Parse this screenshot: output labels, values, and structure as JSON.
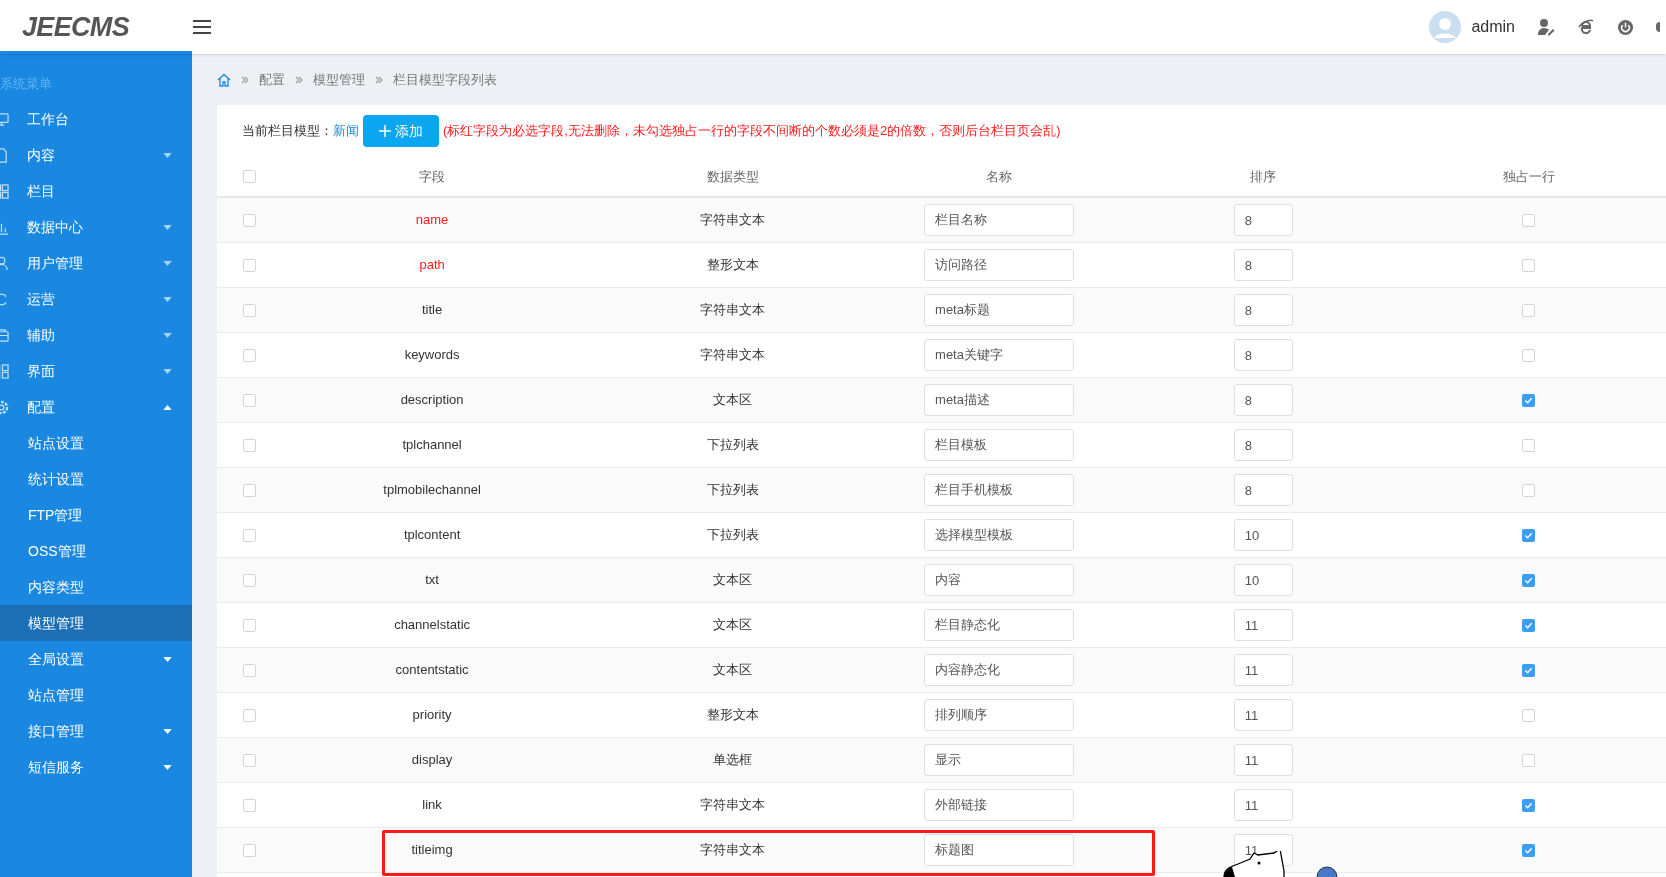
{
  "topbar": {
    "logo": "JEECMS",
    "user": "admin"
  },
  "sidebar": {
    "heading": "系统菜单",
    "items": [
      {
        "label": "工作台",
        "kind": "top",
        "selected": false
      },
      {
        "label": "内容",
        "kind": "top",
        "expanded": false,
        "selected": false
      },
      {
        "label": "栏目",
        "kind": "top",
        "selected": false
      },
      {
        "label": "数据中心",
        "kind": "top",
        "expanded": false,
        "selected": false
      },
      {
        "label": "用户管理",
        "kind": "top",
        "expanded": false,
        "selected": false
      },
      {
        "label": "运营",
        "kind": "top",
        "expanded": false,
        "selected": false
      },
      {
        "label": "辅助",
        "kind": "top",
        "expanded": false,
        "selected": false
      },
      {
        "label": "界面",
        "kind": "top",
        "expanded": false,
        "selected": false
      },
      {
        "label": "配置",
        "kind": "top",
        "expanded": true,
        "selected": false
      },
      {
        "label": "站点设置",
        "kind": "sub",
        "selected": false
      },
      {
        "label": "统计设置",
        "kind": "sub",
        "selected": false
      },
      {
        "label": "FTP管理",
        "kind": "sub",
        "selected": false
      },
      {
        "label": "OSS管理",
        "kind": "sub",
        "selected": false
      },
      {
        "label": "内容类型",
        "kind": "sub",
        "selected": false
      },
      {
        "label": "模型管理",
        "kind": "sub",
        "selected": true
      },
      {
        "label": "全局设置",
        "kind": "sub",
        "expanded": false,
        "selected": false
      },
      {
        "label": "站点管理",
        "kind": "sub",
        "selected": false
      },
      {
        "label": "接口管理",
        "kind": "sub",
        "expanded": false,
        "selected": false
      },
      {
        "label": "短信服务",
        "kind": "sub",
        "expanded": false,
        "selected": false
      }
    ]
  },
  "breadcrumb": [
    "配置",
    "模型管理",
    "栏目模型字段列表"
  ],
  "toolbar": {
    "label": "当前栏目模型：",
    "model": "新闻",
    "add_button": "添加",
    "notice": "(标红字段为必选字段,无法删除，未勾选独占一行的字段不间断的个数必须是2的倍数，否则后台栏目页会乱)"
  },
  "table": {
    "columns": [
      "字段",
      "数据类型",
      "名称",
      "排序",
      "独占一行"
    ],
    "header_checked": false,
    "rows": [
      {
        "field": "name",
        "type": "字符串文本",
        "name": "栏目名称",
        "order": "8",
        "single_line": false,
        "required": true,
        "selected": false,
        "highlighted": false
      },
      {
        "field": "path",
        "type": "整形文本",
        "name": "访问路径",
        "order": "8",
        "single_line": false,
        "required": true,
        "selected": false,
        "highlighted": false
      },
      {
        "field": "title",
        "type": "字符串文本",
        "name": "meta标题",
        "order": "8",
        "single_line": false,
        "required": false,
        "selected": false,
        "highlighted": false
      },
      {
        "field": "keywords",
        "type": "字符串文本",
        "name": "meta关键字",
        "order": "8",
        "single_line": false,
        "required": false,
        "selected": false,
        "highlighted": false
      },
      {
        "field": "description",
        "type": "文本区",
        "name": "meta描述",
        "order": "8",
        "single_line": true,
        "required": false,
        "selected": false,
        "highlighted": false
      },
      {
        "field": "tplchannel",
        "type": "下拉列表",
        "name": "栏目模板",
        "order": "8",
        "single_line": false,
        "required": false,
        "selected": false,
        "highlighted": false
      },
      {
        "field": "tplmobilechannel",
        "type": "下拉列表",
        "name": "栏目手机模板",
        "order": "8",
        "single_line": false,
        "required": false,
        "selected": false,
        "highlighted": false
      },
      {
        "field": "tplcontent",
        "type": "下拉列表",
        "name": "选择模型模板",
        "order": "10",
        "single_line": true,
        "required": false,
        "selected": false,
        "highlighted": false
      },
      {
        "field": "txt",
        "type": "文本区",
        "name": "内容",
        "order": "10",
        "single_line": true,
        "required": false,
        "selected": false,
        "highlighted": false
      },
      {
        "field": "channelstatic",
        "type": "文本区",
        "name": "栏目静态化",
        "order": "11",
        "single_line": true,
        "required": false,
        "selected": false,
        "highlighted": false
      },
      {
        "field": "contentstatic",
        "type": "文本区",
        "name": "内容静态化",
        "order": "11",
        "single_line": true,
        "required": false,
        "selected": false,
        "highlighted": false
      },
      {
        "field": "priority",
        "type": "整形文本",
        "name": "排列顺序",
        "order": "11",
        "single_line": false,
        "required": false,
        "selected": false,
        "highlighted": false
      },
      {
        "field": "display",
        "type": "单选框",
        "name": "显示",
        "order": "11",
        "single_line": false,
        "required": false,
        "selected": false,
        "highlighted": false
      },
      {
        "field": "link",
        "type": "字符串文本",
        "name": "外部链接",
        "order": "11",
        "single_line": true,
        "required": false,
        "selected": false,
        "highlighted": false
      },
      {
        "field": "titleimg",
        "type": "字符串文本",
        "name": "标题图",
        "order": "11",
        "single_line": true,
        "required": false,
        "selected": false,
        "highlighted": true
      }
    ]
  }
}
